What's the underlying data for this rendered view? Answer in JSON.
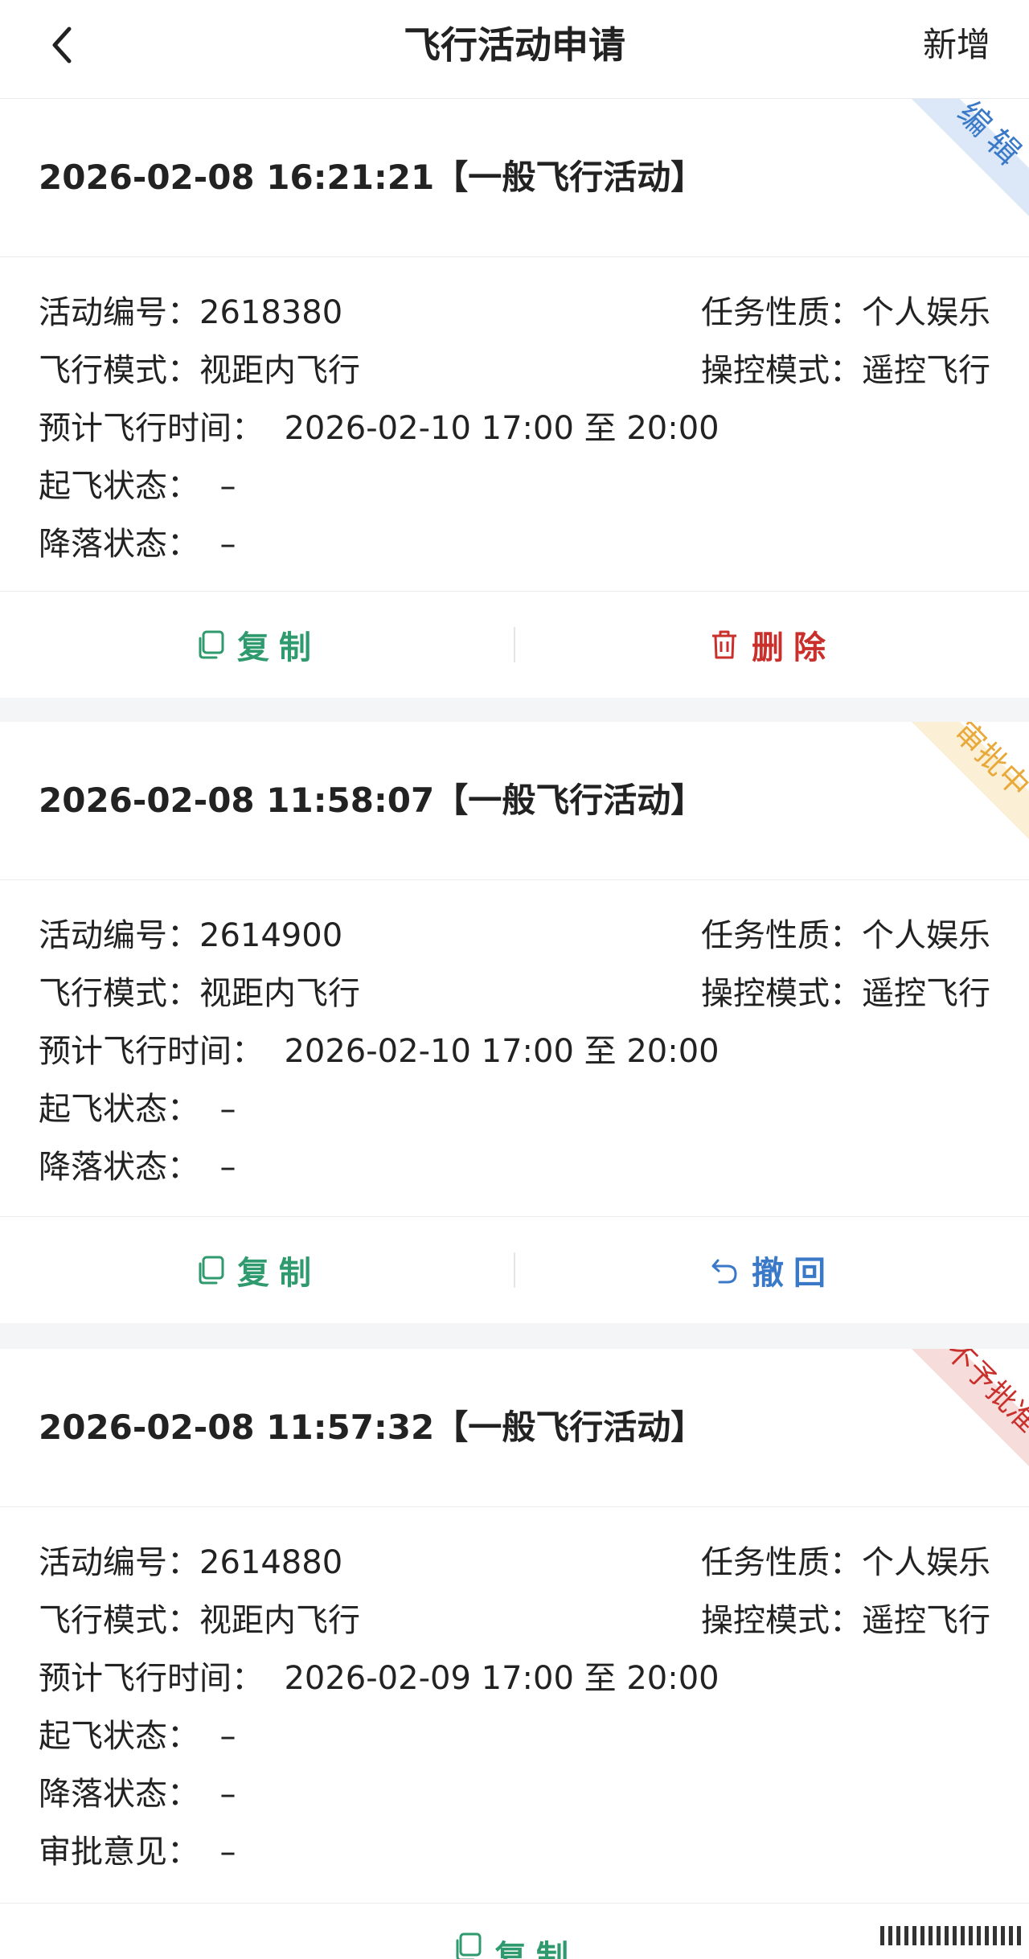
{
  "nav": {
    "title": "飞行活动申请",
    "add_label": "新增",
    "back_icon": "chevron-left-icon"
  },
  "labels": {
    "activity_no": "活动编号：",
    "task_nature": "任务性质：",
    "flight_mode": "飞行模式：",
    "control_mode": "操控模式：",
    "planned_time": "预计飞行时间：",
    "takeoff_status": "起飞状态：",
    "landing_status": "降落状态：",
    "approval_opinion": "审批意见：",
    "to": "至"
  },
  "cards": [
    {
      "title": "2026-02-08 16:21:21【一般飞行活动】",
      "status": "编辑",
      "status_color": "#3a79c8",
      "ribbon_color": "#dce8f7",
      "activity_no": "2618380",
      "task_nature": "个人娱乐",
      "flight_mode": "视距内飞行",
      "control_mode": "遥控飞行",
      "planned_time": "2026-02-10 17:00 至 20:00",
      "takeoff_status": "–",
      "landing_status": "–",
      "actions": [
        {
          "label": "复制",
          "icon": "copy-icon",
          "color": "#2f9a6e"
        },
        {
          "label": "删除",
          "icon": "trash-icon",
          "color": "#c9302c"
        }
      ]
    },
    {
      "title": "2026-02-08 11:58:07【一般飞行活动】",
      "status": "审批中",
      "status_color": "#e8a93a",
      "ribbon_color": "#fbefd6",
      "activity_no": "2614900",
      "task_nature": "个人娱乐",
      "flight_mode": "视距内飞行",
      "control_mode": "遥控飞行",
      "planned_time": "2026-02-10 17:00 至 20:00",
      "takeoff_status": "–",
      "landing_status": "–",
      "actions": [
        {
          "label": "复制",
          "icon": "copy-icon",
          "color": "#2f9a6e"
        },
        {
          "label": "撤回",
          "icon": "undo-icon",
          "color": "#3a79c8"
        }
      ]
    },
    {
      "title": "2026-02-08 11:57:32【一般飞行活动】",
      "status": "不予批准",
      "status_color": "#c9302c",
      "ribbon_color": "#f7dcdc",
      "activity_no": "2614880",
      "task_nature": "个人娱乐",
      "flight_mode": "视距内飞行",
      "control_mode": "遥控飞行",
      "planned_time": "2026-02-09 17:00 至 20:00",
      "takeoff_status": "–",
      "landing_status": "–",
      "approval_opinion": "–",
      "actions": [
        {
          "label": "复制",
          "icon": "copy-icon",
          "color": "#2f9a6e"
        }
      ]
    }
  ]
}
